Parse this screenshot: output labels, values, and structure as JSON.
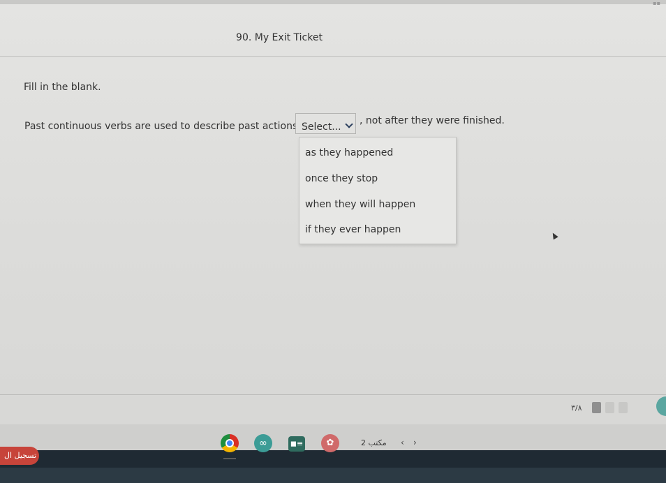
{
  "page": {
    "title": "90. My Exit Ticket",
    "instruction": "Fill in the blank."
  },
  "question": {
    "before_text": "Past continuous verbs are used to describe past actions",
    "select_placeholder": "Select...",
    "after_text": ", not after they were finished.",
    "options": [
      "as they happened",
      "once they stop",
      "when they will happen",
      "if they ever happen"
    ]
  },
  "footer": {
    "page_indicator": "٣/٨"
  },
  "taskbar": {
    "start_label": "تسجيل ال",
    "office_label": "2 مكتب",
    "prev_glyph": "‹",
    "next_glyph": "›",
    "app2_glyph": "∞",
    "app3_glyph": "◼≡",
    "app4_glyph": "✿"
  },
  "colors": {
    "accent_teal": "#5aa6a0",
    "start_red": "#c7443a",
    "taskbar_dark": "#1f2a33",
    "caret_navy": "#2b3f5e"
  }
}
